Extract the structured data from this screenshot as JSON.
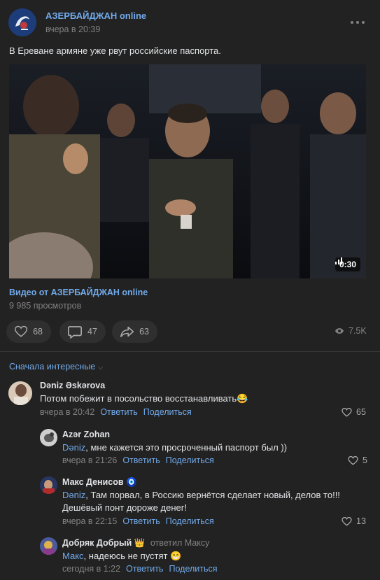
{
  "post": {
    "group_name": "АЗЕРБАЙДЖАН online",
    "time": "вчера в 20:39",
    "text": "В Ереване армяне уже рвут российские паспорта.",
    "video": {
      "duration": "0:30",
      "title": "Видео от АЗЕРБАЙДЖАН online",
      "views": "9 985 просмотров"
    },
    "actions": {
      "likes": "68",
      "comments": "47",
      "shares": "63",
      "views": "7.5K"
    }
  },
  "comments_section": {
    "sort_label": "Сначала интересные"
  },
  "comments": [
    {
      "author": "Dəniz Əskərova",
      "text": "Потом побежит в посольство восстанавливать😂",
      "time": "вчера в 20:42",
      "reply_label": "Ответить",
      "share_label": "Поделиться",
      "likes": "65"
    },
    {
      "author": "Azər Zohan",
      "mention": "Dəniz",
      "text": ", мне кажется это просроченный паспорт был ))",
      "time": "вчера в 21:26",
      "reply_label": "Ответить",
      "share_label": "Поделиться",
      "likes": "5"
    },
    {
      "author": "Макс Денисов 🧿",
      "mention": "Dəniz",
      "text_line1": ", Там порвал, в Россию вернётся сделает новый, делов то!!!",
      "text_line2": "Дешёвый понт дороже денег!",
      "time": "вчера в 22:15",
      "reply_label": "Ответить",
      "share_label": "Поделиться",
      "likes": "13"
    },
    {
      "author": "Добряк Добрый 👑",
      "replied_to": "ответил Максу",
      "mention": "Макс",
      "text": ", надеюсь не пустят 😁",
      "time": "сегодня в 1:22",
      "reply_label": "Ответить",
      "share_label": "Поделиться"
    }
  ],
  "colors": {
    "background": "#222222",
    "link": "#71aaeb",
    "text": "#e1e3e6",
    "muted": "#828282",
    "pill": "#2f2f2f"
  }
}
